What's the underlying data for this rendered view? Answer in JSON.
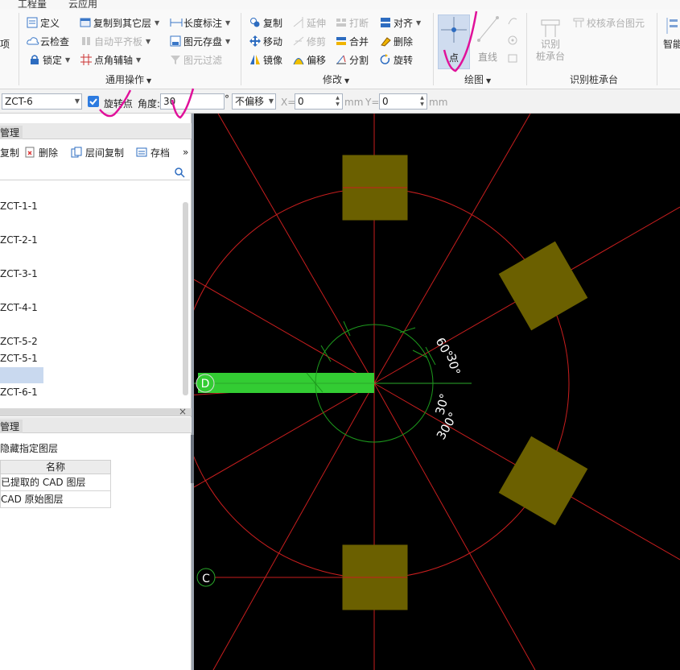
{
  "menubar": {
    "items": [
      "工程量",
      "云应用"
    ]
  },
  "ribbon": {
    "left_cut_label": "项",
    "general": {
      "define": "定义",
      "cloud_check": "云检查",
      "lock": "锁定",
      "copy_to_layer": "复制到其它层",
      "auto_align": "自动平齐板",
      "point_axis": "点角辅轴",
      "length_dim": "长度标注",
      "element_save": "图元存盘",
      "element_filter": "图元过滤",
      "group_label": "通用操作"
    },
    "modify": {
      "copy": "复制",
      "move": "移动",
      "mirror": "镜像",
      "extend": "延伸",
      "trim": "修剪",
      "offset": "偏移",
      "break": "打断",
      "merge": "合并",
      "split": "分割",
      "align": "对齐",
      "delete": "删除",
      "rotate": "旋转",
      "group_label": "修改"
    },
    "draw": {
      "point": "点",
      "line": "直线",
      "group_label": "绘图"
    },
    "identify": {
      "identify_cap": "识别\n桩承台",
      "identify_cap_l1": "识别",
      "identify_cap_l2": "桩承台",
      "verify_cap": "校核承台图元",
      "group_label": "识别桩承台"
    },
    "smart": "智能"
  },
  "props": {
    "element_select": "ZCT-6",
    "rotate_point_checked": true,
    "rotate_point_label": "旋转点",
    "angle_label": "角度:",
    "angle_value": "30",
    "degree": "°",
    "offset_select": "不偏移",
    "x_label": "X=",
    "x_value": "0",
    "mm1": "mm",
    "y_label": "Y=",
    "y_value": "0",
    "mm2": "mm"
  },
  "leftpanel": {
    "tab1": "管理",
    "tools": {
      "copy": "复制",
      "delete": "删除",
      "floor_copy": "层间复制",
      "archive": "存档"
    },
    "items": [
      "ZCT-1-1",
      "ZCT-2-1",
      "ZCT-3-1",
      "ZCT-4-1",
      "ZCT-5-2",
      "ZCT-5-1",
      "ZCT-6-1"
    ],
    "tab2": "管理",
    "hide_layers": "隐藏指定图层",
    "table_header": "名称",
    "table_rows": [
      "已提取的 CAD 图层",
      "CAD 原始图层"
    ]
  },
  "canvas": {
    "axis_d": "D",
    "axis_c": "C",
    "angle_labels": [
      "60°",
      "30°",
      "30°",
      "300°"
    ]
  },
  "colors": {
    "canvas_bg": "#000000",
    "cap_fill": "#6b6000",
    "beam_green": "#33cc33",
    "red_line": "#c81e1e",
    "circle_green": "#1d9a1d",
    "annotation": "#e0119a"
  }
}
